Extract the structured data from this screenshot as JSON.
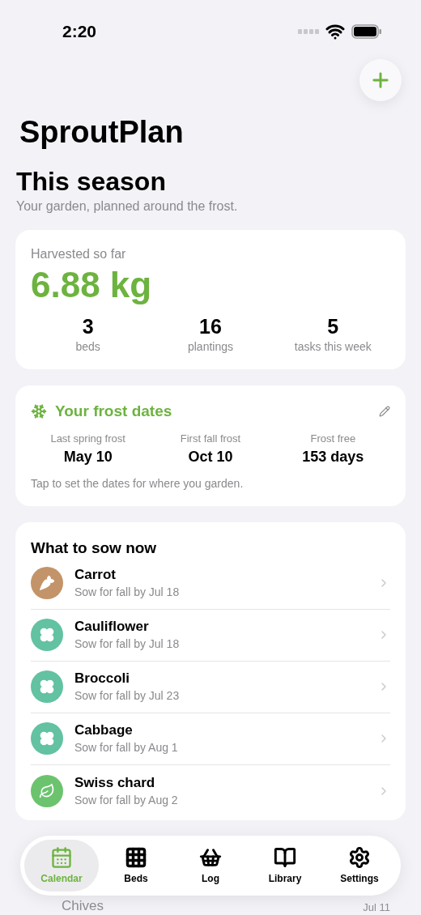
{
  "status_bar": {
    "time": "2:20"
  },
  "app": {
    "title": "SproutPlan"
  },
  "season": {
    "heading": "This season",
    "subtitle": "Your garden, planned around the frost."
  },
  "harvest": {
    "label": "Harvested so far",
    "value": "6.88 kg",
    "stats": [
      {
        "value": "3",
        "label": "beds"
      },
      {
        "value": "16",
        "label": "plantings"
      },
      {
        "value": "5",
        "label": "tasks this week"
      }
    ]
  },
  "frost": {
    "title": "Your frost dates",
    "dates": [
      {
        "label": "Last spring frost",
        "value": "May 10"
      },
      {
        "label": "First fall frost",
        "value": "Oct 10"
      },
      {
        "label": "Frost free",
        "value": "153 days"
      }
    ],
    "hint": "Tap to set the dates for where you garden."
  },
  "sow_now": {
    "title": "What to sow now",
    "items": [
      {
        "name": "Carrot",
        "detail": "Sow for fall by Jul 18",
        "kind": "carrot",
        "color": "#c39469"
      },
      {
        "name": "Cauliflower",
        "detail": "Sow for fall by Jul 18",
        "kind": "flower",
        "color": "#62c2a2"
      },
      {
        "name": "Broccoli",
        "detail": "Sow for fall by Jul 23",
        "kind": "flower",
        "color": "#62c2a2"
      },
      {
        "name": "Cabbage",
        "detail": "Sow for fall by Aug 1",
        "kind": "flower",
        "color": "#62c2a2"
      },
      {
        "name": "Swiss chard",
        "detail": "Sow for fall by Aug 2",
        "kind": "leaf",
        "color": "#6cc36e"
      }
    ]
  },
  "peek_row": {
    "name": "Chives",
    "detail": "Jul 11"
  },
  "tab_bar": [
    {
      "label": "Calendar",
      "kind": "calendar",
      "selected": true
    },
    {
      "label": "Beds",
      "kind": "grid",
      "selected": false
    },
    {
      "label": "Log",
      "kind": "basket",
      "selected": false
    },
    {
      "label": "Library",
      "kind": "book",
      "selected": false
    },
    {
      "label": "Settings",
      "kind": "gear",
      "selected": false
    }
  ]
}
